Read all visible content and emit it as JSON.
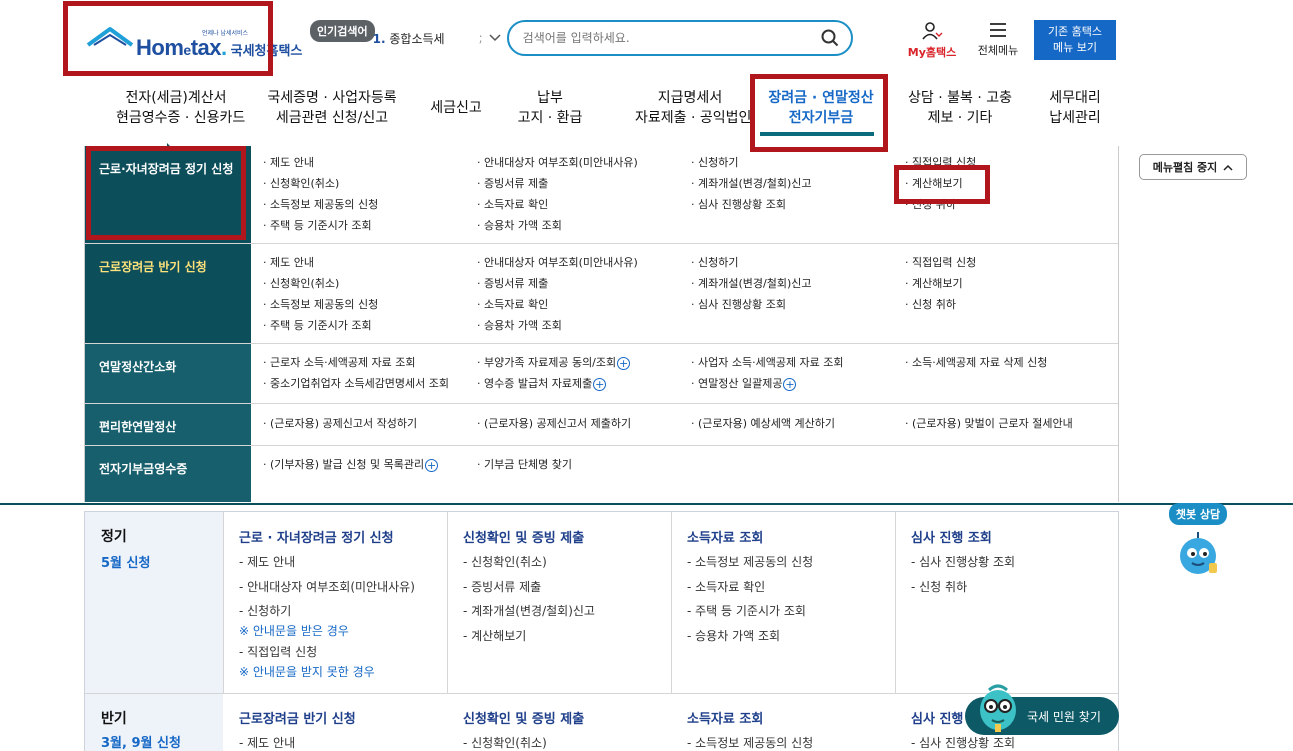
{
  "header": {
    "logo_tagline": "언제나 납세서비스",
    "logo_brand_a": "Hom",
    "logo_brand_e": "e",
    "logo_brand_b": "tax",
    "logo_brand_dot": ".",
    "logo_name": "국세청홈택스",
    "popular_badge": "인기검색어",
    "popular_num": "1.",
    "popular_text": "종합소득세",
    "search_placeholder": "검색어를 입력하세요.",
    "my_home_label": "My홈택스",
    "all_menu_label": "전체메뉴",
    "old_menu_line1": "기존 홈택스",
    "old_menu_line2": "메뉴 보기"
  },
  "nav": {
    "items": [
      {
        "line1": "전자(세금)계산서",
        "line2": "현금영수증 · 신용카드"
      },
      {
        "line1": "국세증명 · 사업자등록",
        "line2": "세금관련 신청/신고"
      },
      {
        "line1": "세금신고",
        "line2": ""
      },
      {
        "line1": "납부",
        "line2": "고지 · 환급"
      },
      {
        "line1": "지급명세서",
        "line2": "자료제출 · 공익법인"
      },
      {
        "line1": "장려금 · 연말정산",
        "line2": "전자기부금"
      },
      {
        "line1": "상담 · 불복 · 고충",
        "line2": "제보 · 기타"
      },
      {
        "line1": "세무대리",
        "line2": "납세관리"
      }
    ]
  },
  "mega_menu": {
    "stop_button": "메뉴펼침 중지",
    "rows": [
      {
        "category": "근로·자녀장려금 정기 신청",
        "cols": [
          [
            "· 제도 안내",
            "· 신청확인(취소)",
            "· 소득정보 제공동의 신청",
            "· 주택 등 기준시가 조회"
          ],
          [
            "· 안내대상자 여부조회(미안내사유)",
            "· 증빙서류 제출",
            "· 소득자료 확인",
            "· 승용차 가액 조회"
          ],
          [
            "· 신청하기",
            "· 계좌개설(변경/철회)신고",
            "· 심사 진행상황 조회"
          ],
          [
            "· 직접입력 신청",
            "· 계산해보기",
            "· 신청 취하"
          ]
        ]
      },
      {
        "category": "근로장려금 반기 신청",
        "cols": [
          [
            "· 제도 안내",
            "· 신청확인(취소)",
            "· 소득정보 제공동의 신청",
            "· 주택 등 기준시가 조회"
          ],
          [
            "· 안내대상자 여부조회(미안내사유)",
            "· 증빙서류 제출",
            "· 소득자료 확인",
            "· 승용차 가액 조회"
          ],
          [
            "· 신청하기",
            "· 계좌개설(변경/철회)신고",
            "· 심사 진행상황 조회"
          ],
          [
            "· 직접입력 신청",
            "· 계산해보기",
            "· 신청 취하"
          ]
        ]
      },
      {
        "category": "연말정산간소화",
        "cols": [
          [
            "· 근로자 소득·세액공제 자료 조회",
            "· 중소기업취업자 소득세감면명세서 조회"
          ],
          [
            "· 부양가족 자료제공 동의/조회",
            "· 영수증 발급처 자료제출"
          ],
          [
            "· 사업자 소득·세액공제 자료 조회",
            "· 연말정산 일괄제공"
          ],
          [
            "· 소득·세액공제 자료 삭제 신청"
          ]
        ]
      },
      {
        "category": "편리한연말정산",
        "cols": [
          [
            "· (근로자용) 공제신고서 작성하기"
          ],
          [
            "· (근로자용) 공제신고서 제출하기"
          ],
          [
            "· (근로자용) 예상세액 계산하기"
          ],
          [
            "· (근로자용) 맞벌이 근로자 절세안내"
          ]
        ]
      },
      {
        "category": "전자기부금영수증",
        "cols": [
          [
            "· (기부자용) 발급 신청 및 목록관리"
          ],
          [
            "· 기부금 단체명 찾기"
          ]
        ]
      }
    ]
  },
  "content": {
    "regular": {
      "label": "정기",
      "sub": "5월 신청",
      "col1_title": "근로 · 자녀장려금 정기 신청",
      "col1_items": [
        "- 제도 안내",
        "- 안내대상자 여부조회(미안내사유)",
        "- 신청하기",
        "※ 안내문을 받은 경우",
        "- 직접입력 신청",
        "※ 안내문을 받지 못한 경우"
      ],
      "col2_title": "신청확인 및 증빙 제출",
      "col2_items": [
        "- 신청확인(취소)",
        "- 증빙서류 제출",
        "- 계좌개설(변경/철회)신고",
        "- 계산해보기"
      ],
      "col3_title": "소득자료 조회",
      "col3_items": [
        "- 소득정보 제공동의 신청",
        "- 소득자료 확인",
        "- 주택 등 기준시가 조회",
        "- 승용차 가액 조회"
      ],
      "col4_title": "심사 진행 조회",
      "col4_items": [
        "- 심사 진행상황 조회",
        "- 신청 취하"
      ]
    },
    "half": {
      "label": "반기",
      "sub": "3월, 9월 신청",
      "col1_title": "근로장려금 반기 신청",
      "col1_items": [
        "- 제도 안내"
      ],
      "col2_title": "신청확인 및 증빙 제출",
      "col2_items": [
        "- 신청확인(취소)"
      ],
      "col3_title": "소득자료 조회",
      "col3_items": [
        "- 소득정보 제공동의 신청"
      ],
      "col4_title": "심사 진행 조회",
      "col4_items": [
        "- 심사 진행상황 조회"
      ]
    }
  },
  "chatbot_label": "챗봇 상담",
  "civil_button": "국세 민원 찾기",
  "colors": {
    "brand_blue": "#1f4fa0",
    "accent_blue": "#1668c6",
    "teal": "#185f6d",
    "teal_dark": "#0d4e5b",
    "annotation_red": "#b0161c"
  }
}
